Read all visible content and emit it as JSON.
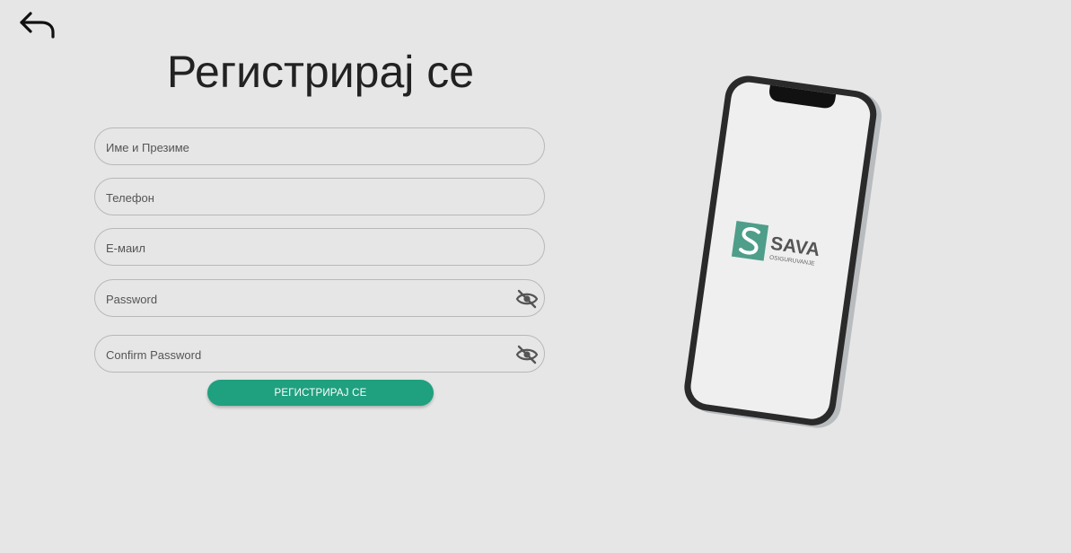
{
  "form": {
    "title": "Регистрирај се",
    "fields": {
      "name": {
        "placeholder": "Име и Презиме",
        "value": ""
      },
      "phone": {
        "placeholder": "Телефон",
        "value": ""
      },
      "email": {
        "placeholder": "Е-маил",
        "value": ""
      },
      "password": {
        "placeholder": "Password",
        "value": ""
      },
      "confirm_password": {
        "placeholder": "Confirm Password",
        "value": ""
      }
    },
    "submit_label": "РЕГИСТРИРАЈ СЕ"
  },
  "illustration": {
    "brand_name": "SAVA",
    "brand_tagline": "OSIGURUVANJE",
    "brand_color": "#4e9e8a"
  },
  "colors": {
    "accent": "#1fa07f",
    "background": "#e6e6e6"
  },
  "icons": {
    "back": "undo-arrow-icon",
    "password_visibility": "eye-slash-icon"
  }
}
